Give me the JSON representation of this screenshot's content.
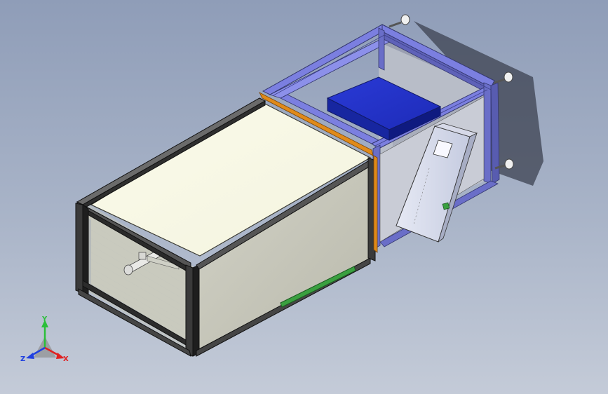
{
  "scene": {
    "description_hidden": false,
    "background_top": "#8f9db8",
    "background_bottom": "#c4cbd8"
  },
  "triad": {
    "y_label": "Y",
    "x_label": "X",
    "z_label": "Z",
    "y_color": "#2bbf3a",
    "x_color": "#e02020",
    "z_color": "#2040e0"
  },
  "colors": {
    "frame_blue": "#7b7fe0",
    "box_blue": "#2233cc",
    "panel_cream": "#fcfcf0",
    "panel_grey": "#c8c8bc",
    "accent_orange": "#e08a1a",
    "accent_green": "#3aa040"
  }
}
